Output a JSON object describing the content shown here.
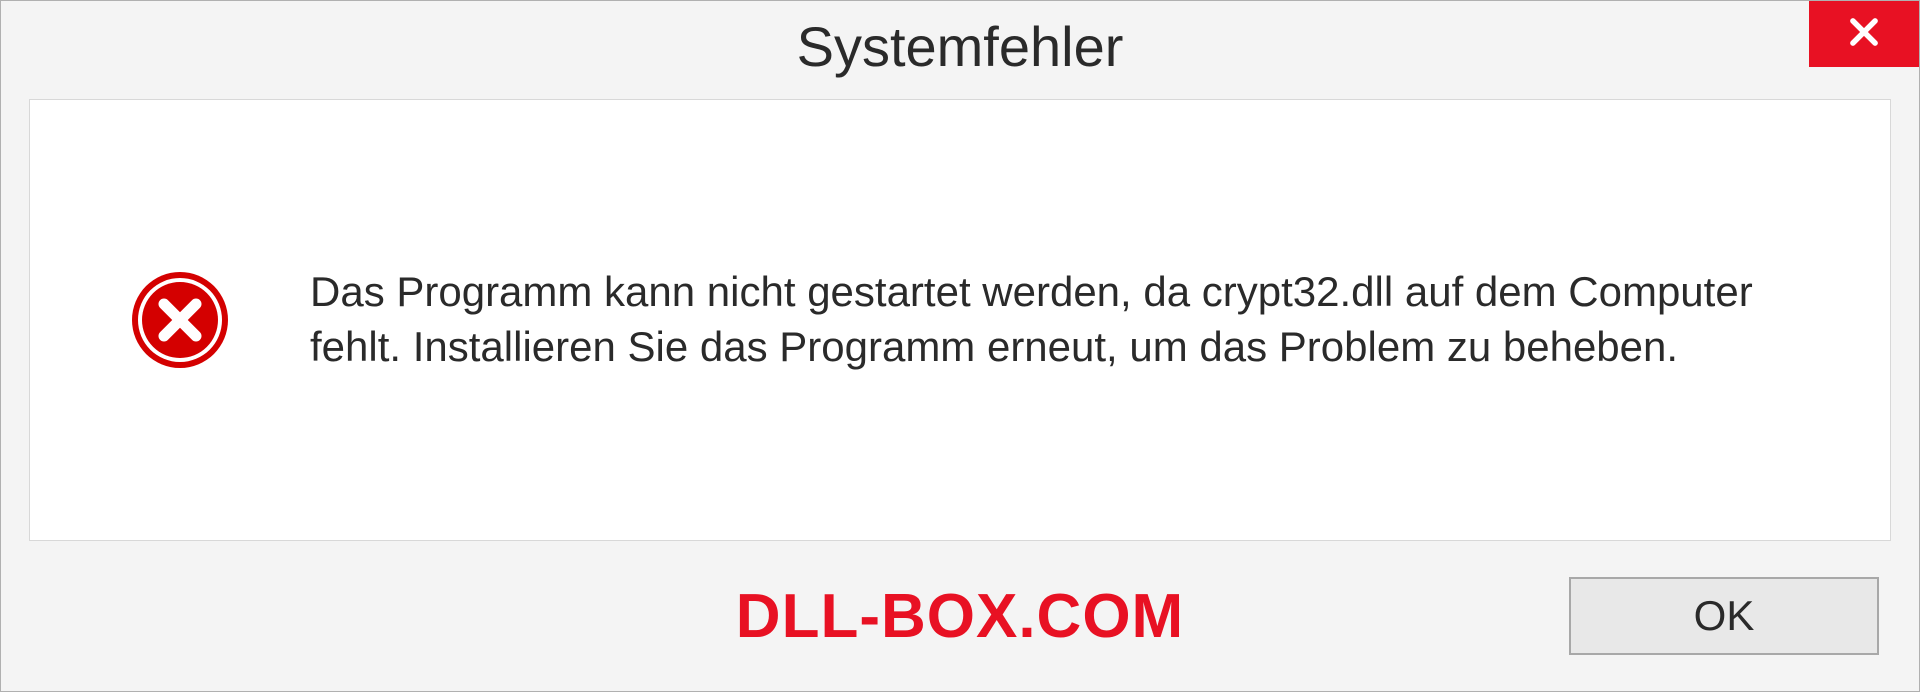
{
  "dialog": {
    "title": "Systemfehler",
    "message": "Das Programm kann nicht gestartet werden, da crypt32.dll auf dem Computer fehlt. Installieren Sie das Programm erneut, um das Problem zu beheben.",
    "ok_label": "OK"
  },
  "watermark": "DLL-BOX.COM"
}
